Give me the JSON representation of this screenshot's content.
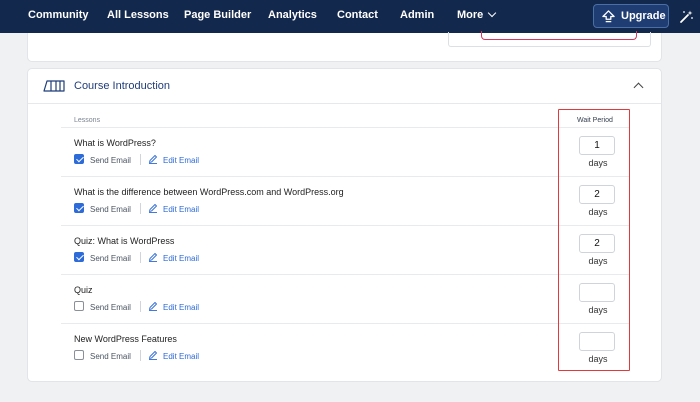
{
  "nav": {
    "items": [
      "Community",
      "All Lessons",
      "Page Builder",
      "Analytics",
      "Contact",
      "Admin",
      "More"
    ],
    "upgrade_label": "Upgrade"
  },
  "card": {
    "title": "Course Introduction",
    "columns": {
      "lessons": "Lessons",
      "wait_period": "Wait Period"
    }
  },
  "lessons": [
    {
      "title": "What is WordPress?",
      "send_email": true,
      "send_label": "Send Email",
      "edit_label": "Edit Email",
      "wait": "1",
      "unit": "days"
    },
    {
      "title": "What is the difference between WordPress.com and WordPress.org",
      "send_email": true,
      "send_label": "Send Email",
      "edit_label": "Edit Email",
      "wait": "2",
      "unit": "days"
    },
    {
      "title": "Quiz: What is WordPress",
      "send_email": true,
      "send_label": "Send Email",
      "edit_label": "Edit Email",
      "wait": "2",
      "unit": "days"
    },
    {
      "title": "Quiz",
      "send_email": false,
      "send_label": "Send Email",
      "edit_label": "Edit Email",
      "wait": "",
      "unit": "days"
    },
    {
      "title": "New WordPress Features",
      "send_email": false,
      "send_label": "Send Email",
      "edit_label": "Edit Email",
      "wait": "",
      "unit": "days"
    }
  ],
  "colors": {
    "nav_bg": "#13284d",
    "accent": "#2d6bd8",
    "highlight": "#e03a3a"
  }
}
